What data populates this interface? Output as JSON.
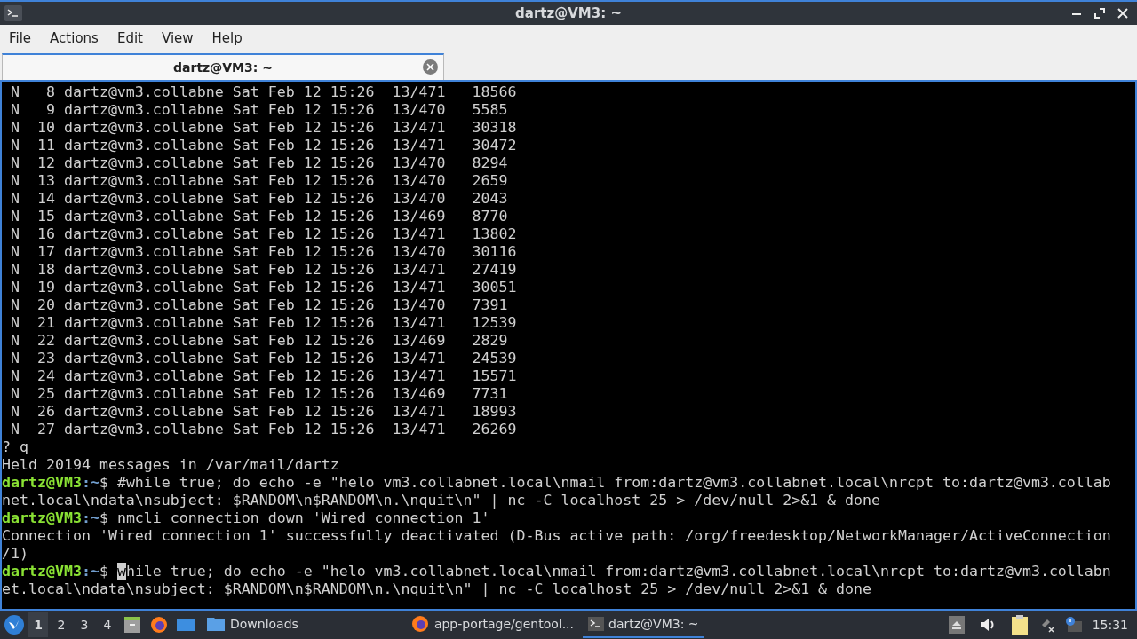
{
  "window": {
    "title": "dartz@VM3: ~"
  },
  "menu": [
    "File",
    "Actions",
    "Edit",
    "View",
    "Help"
  ],
  "tabs": [
    {
      "label": "dartz@VM3: ~",
      "selected": true
    }
  ],
  "terminal": {
    "lines": [
      {
        "kind": "output",
        "text": " N   8 dartz@vm3.collabne Sat Feb 12 15:26  13/471   18566"
      },
      {
        "kind": "output",
        "text": " N   9 dartz@vm3.collabne Sat Feb 12 15:26  13/470   5585"
      },
      {
        "kind": "output",
        "text": " N  10 dartz@vm3.collabne Sat Feb 12 15:26  13/471   30318"
      },
      {
        "kind": "output",
        "text": " N  11 dartz@vm3.collabne Sat Feb 12 15:26  13/471   30472"
      },
      {
        "kind": "output",
        "text": " N  12 dartz@vm3.collabne Sat Feb 12 15:26  13/470   8294"
      },
      {
        "kind": "output",
        "text": " N  13 dartz@vm3.collabne Sat Feb 12 15:26  13/470   2659"
      },
      {
        "kind": "output",
        "text": " N  14 dartz@vm3.collabne Sat Feb 12 15:26  13/470   2043"
      },
      {
        "kind": "output",
        "text": " N  15 dartz@vm3.collabne Sat Feb 12 15:26  13/469   8770"
      },
      {
        "kind": "output",
        "text": " N  16 dartz@vm3.collabne Sat Feb 12 15:26  13/471   13802"
      },
      {
        "kind": "output",
        "text": " N  17 dartz@vm3.collabne Sat Feb 12 15:26  13/470   30116"
      },
      {
        "kind": "output",
        "text": " N  18 dartz@vm3.collabne Sat Feb 12 15:26  13/471   27419"
      },
      {
        "kind": "output",
        "text": " N  19 dartz@vm3.collabne Sat Feb 12 15:26  13/471   30051"
      },
      {
        "kind": "output",
        "text": " N  20 dartz@vm3.collabne Sat Feb 12 15:26  13/470   7391"
      },
      {
        "kind": "output",
        "text": " N  21 dartz@vm3.collabne Sat Feb 12 15:26  13/471   12539"
      },
      {
        "kind": "output",
        "text": " N  22 dartz@vm3.collabne Sat Feb 12 15:26  13/469   2829"
      },
      {
        "kind": "output",
        "text": " N  23 dartz@vm3.collabne Sat Feb 12 15:26  13/471   24539"
      },
      {
        "kind": "output",
        "text": " N  24 dartz@vm3.collabne Sat Feb 12 15:26  13/471   15571"
      },
      {
        "kind": "output",
        "text": " N  25 dartz@vm3.collabne Sat Feb 12 15:26  13/469   7731"
      },
      {
        "kind": "output",
        "text": " N  26 dartz@vm3.collabne Sat Feb 12 15:26  13/471   18993"
      },
      {
        "kind": "output",
        "text": " N  27 dartz@vm3.collabne Sat Feb 12 15:26  13/471   26269"
      },
      {
        "kind": "output",
        "text": "? q"
      },
      {
        "kind": "output",
        "text": "Held 20194 messages in /var/mail/dartz"
      },
      {
        "kind": "prompt",
        "user_host": "dartz@VM3",
        "path": ":~",
        "symbol": "$ ",
        "command": "#while true; do echo -e \"helo vm3.collabnet.local\\nmail from:dartz@vm3.collabnet.local\\nrcpt to:dartz@vm3.collab"
      },
      {
        "kind": "output",
        "text": "net.local\\ndata\\nsubject: $RANDOM\\n$RANDOM\\n.\\nquit\\n\" | nc -C localhost 25 > /dev/null 2>&1 & done"
      },
      {
        "kind": "prompt",
        "user_host": "dartz@VM3",
        "path": ":~",
        "symbol": "$ ",
        "command": "nmcli connection down 'Wired connection 1'"
      },
      {
        "kind": "output",
        "text": "Connection 'Wired connection 1' successfully deactivated (D-Bus active path: /org/freedesktop/NetworkManager/ActiveConnection"
      },
      {
        "kind": "output",
        "text": "/1)"
      },
      {
        "kind": "prompt",
        "user_host": "dartz@VM3",
        "path": ":~",
        "symbol": "$ ",
        "cursor": "w",
        "command_after": "hile true; do echo -e \"helo vm3.collabnet.local\\nmail from:dartz@vm3.collabnet.local\\nrcpt to:dartz@vm3.collabn"
      },
      {
        "kind": "output",
        "text": "et.local\\ndata\\nsubject: $RANDOM\\n$RANDOM\\n.\\nquit\\n\" | nc -C localhost 25 > /dev/null 2>&1 & done"
      }
    ]
  },
  "taskbar": {
    "desktops": [
      {
        "label": "1",
        "selected": true
      },
      {
        "label": "2",
        "selected": false
      },
      {
        "label": "3",
        "selected": false
      },
      {
        "label": "4",
        "selected": false
      }
    ],
    "quicklaunch": [
      {
        "kind": "files"
      },
      {
        "kind": "browser"
      },
      {
        "kind": "desktop"
      }
    ],
    "windows": [
      {
        "kind": "folder",
        "label": "Downloads",
        "selected": false
      },
      {
        "kind": "browser",
        "label": "app-portage/gentool...",
        "selected": false
      },
      {
        "kind": "terminal",
        "label": "dartz@VM3: ~",
        "selected": true
      }
    ],
    "clock": "15:31"
  }
}
